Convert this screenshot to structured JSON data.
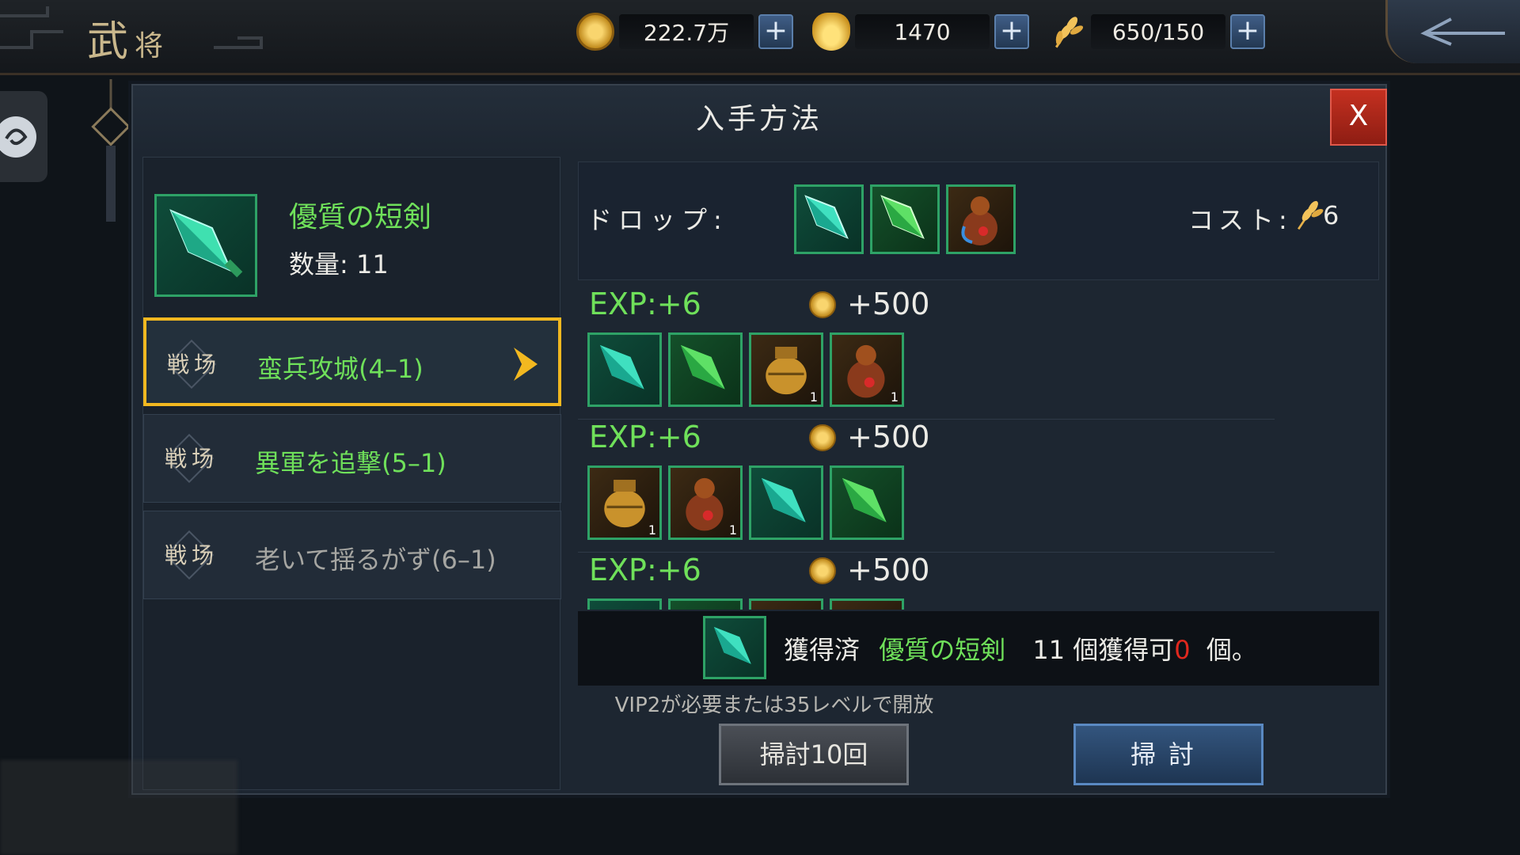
{
  "header": {
    "title_main": "武",
    "title_small": "将",
    "resources": [
      {
        "icon": "coin-icon",
        "value": "222.7万"
      },
      {
        "icon": "ingot-icon",
        "value": "1470"
      },
      {
        "icon": "grain-icon",
        "value": "650/150"
      }
    ],
    "plus_label": "+"
  },
  "dialog": {
    "title": "入手方法",
    "close_label": "X"
  },
  "item": {
    "name": "優質の短剣",
    "quantity": "数量: 11"
  },
  "stages": [
    {
      "badge": "戦场",
      "name": "蛮兵攻城(4–1)",
      "selected": true,
      "name_color": "#6fe05a"
    },
    {
      "badge": "戦场",
      "name": "異軍を追撃(5–1)",
      "selected": false,
      "name_color": "#6fe05a"
    },
    {
      "badge": "戦场",
      "name": "老いて揺るがず(6–1)",
      "selected": false,
      "name_color": "#a6a6a2"
    }
  ],
  "drop": {
    "label": "ドロップ:",
    "items": [
      "teal-dagger-icon",
      "green-dagger-icon",
      "gourd-icon"
    ],
    "cost_label": "コスト:",
    "cost_value": "6"
  },
  "rewards": [
    {
      "exp": "EXP:+6",
      "gold": "+500",
      "items": [
        {
          "icon": "teal-dagger-icon",
          "count": ""
        },
        {
          "icon": "green-dagger-icon",
          "count": ""
        },
        {
          "icon": "gold-jar-icon",
          "count": "1"
        },
        {
          "icon": "gourd-icon",
          "count": "1"
        }
      ]
    },
    {
      "exp": "EXP:+6",
      "gold": "+500",
      "items": [
        {
          "icon": "gold-jar-icon",
          "count": "1"
        },
        {
          "icon": "gourd-icon",
          "count": "1"
        },
        {
          "icon": "teal-dagger-icon",
          "count": ""
        },
        {
          "icon": "green-dagger-icon",
          "count": ""
        }
      ]
    },
    {
      "exp": "EXP:+6",
      "gold": "+500",
      "items": [
        {
          "icon": "teal-dagger-icon",
          "count": ""
        },
        {
          "icon": "green-dagger-icon",
          "count": ""
        },
        {
          "icon": "gold-jar-icon",
          "count": ""
        },
        {
          "icon": "gourd-icon",
          "count": ""
        }
      ]
    }
  ],
  "acquired": {
    "prefix": "獲得済",
    "item_name": "優質の短剣",
    "count_text": "11 個獲得可",
    "zero": "0",
    "suffix": "個。"
  },
  "vip_note": "VIP2が必要または35レベルで開放",
  "buttons": {
    "sweep10": "掃討10回",
    "sweep": "掃討"
  },
  "colors": {
    "accent_green": "#6fe05a",
    "selected_border": "#f2b820",
    "close_red": "#c43020",
    "zero_red": "#e0281e"
  }
}
